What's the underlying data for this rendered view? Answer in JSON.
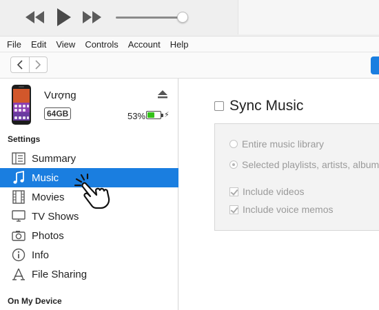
{
  "player": {
    "controls": [
      "rewind-icon",
      "play-icon",
      "fast-forward-icon"
    ],
    "volume_level": 0.92
  },
  "menu": [
    "File",
    "Edit",
    "View",
    "Controls",
    "Account",
    "Help"
  ],
  "device": {
    "name": "Vượng",
    "capacity": "64GB",
    "battery_percent": "53%",
    "battery_level": 0.53
  },
  "sidebar": {
    "settings_title": "Settings",
    "items": [
      {
        "label": "Summary",
        "icon": "summary-icon"
      },
      {
        "label": "Music",
        "icon": "music-note-icon",
        "selected": true
      },
      {
        "label": "Movies",
        "icon": "film-icon"
      },
      {
        "label": "TV Shows",
        "icon": "tv-icon"
      },
      {
        "label": "Photos",
        "icon": "camera-icon"
      },
      {
        "label": "Info",
        "icon": "info-icon"
      },
      {
        "label": "File Sharing",
        "icon": "apps-icon"
      }
    ],
    "on_my_device_title": "On My Device"
  },
  "content": {
    "sync_title": "Sync Music",
    "sync_checked": false,
    "radio_options": [
      "Entire music library",
      "Selected playlists, artists, albums,"
    ],
    "selected_radio": 1,
    "checkbox_options": [
      "Include videos",
      "Include voice memos"
    ]
  },
  "colors": {
    "accent": "#1a7ee0",
    "battery": "#34c21a"
  }
}
